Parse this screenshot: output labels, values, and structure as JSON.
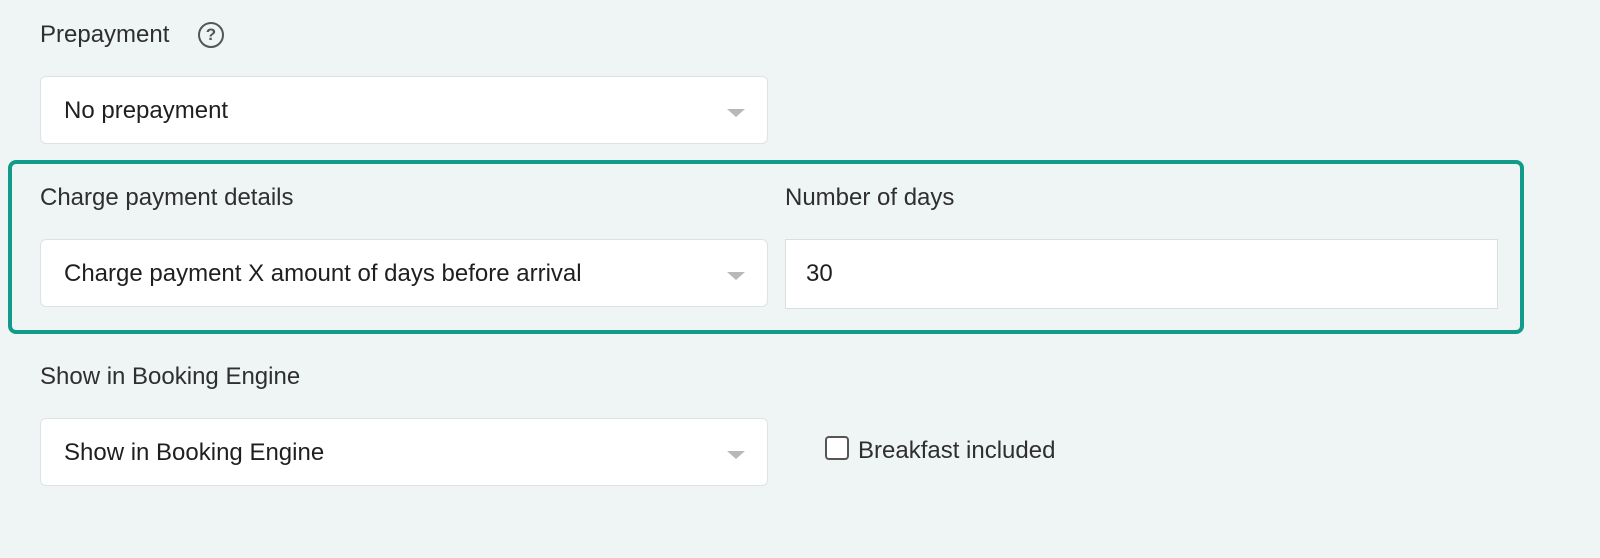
{
  "prepayment": {
    "label": "Prepayment",
    "help_icon": "question-circle-icon",
    "selected": "No prepayment"
  },
  "charge_details": {
    "label": "Charge payment details",
    "selected": "Charge payment X amount of days before arrival"
  },
  "number_of_days": {
    "label": "Number of days",
    "value": "30"
  },
  "booking_engine": {
    "label": "Show in Booking Engine",
    "selected": "Show in Booking Engine"
  },
  "breakfast": {
    "label": "Breakfast included",
    "checked": false
  },
  "colors": {
    "highlight_border": "#129b8a",
    "background": "#eff4f4"
  }
}
